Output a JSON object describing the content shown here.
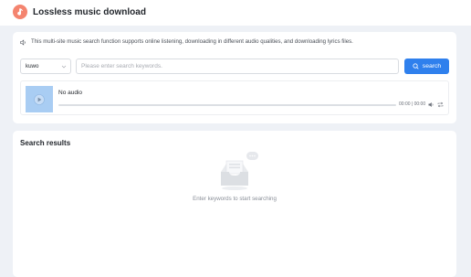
{
  "header": {
    "app_title": "Lossless music download",
    "logo_color": "#f4846f"
  },
  "notice": {
    "icon": "speaker-icon",
    "text": "This multi-site music search function supports online listening, downloading in different audio qualities, and downloading lyrics files."
  },
  "search": {
    "source_selected": "kuwo",
    "placeholder": "Please enter search keywords.",
    "value": "",
    "button_label": "search",
    "button_color": "#2f80ed"
  },
  "player": {
    "track_title": "No audio",
    "time": "00:00 | 00:00",
    "cover_color": "#a9cdf3",
    "progress": 0
  },
  "results": {
    "title": "Search results",
    "empty_text": "Enter keywords to start searching"
  }
}
